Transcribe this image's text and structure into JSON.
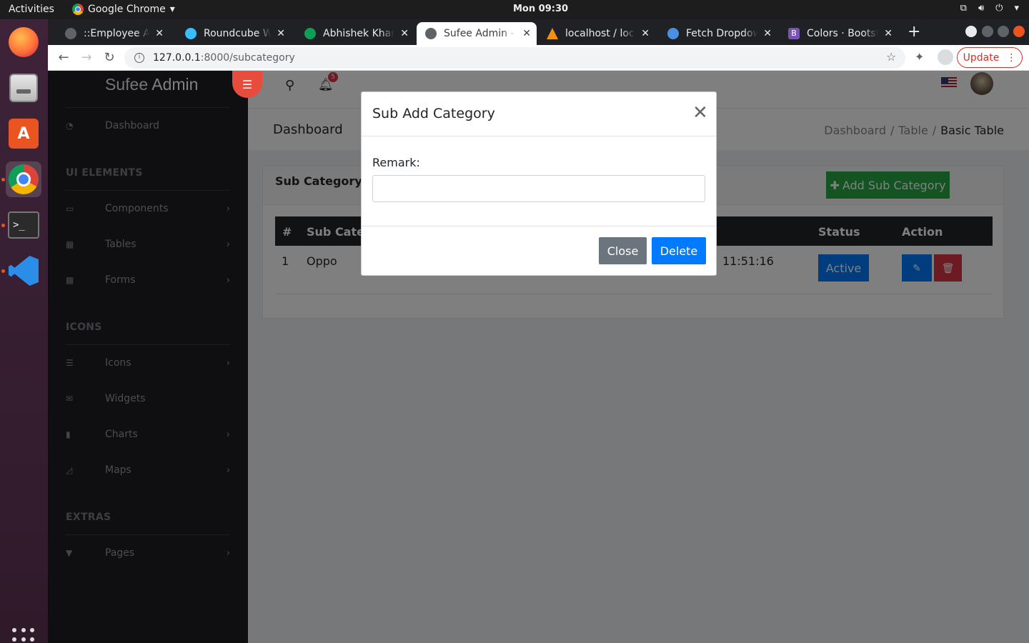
{
  "system": {
    "activities_label": "Activities",
    "app_name": "Google Chrome",
    "clock": "Mon 09:30"
  },
  "browser": {
    "tabs": [
      {
        "title": "::Employee Adm",
        "favicon_color": "#5f6368"
      },
      {
        "title": "Roundcube We",
        "favicon_color": "#37beff"
      },
      {
        "title": "Abhishek Khan",
        "favicon_color": "#0f9d58"
      },
      {
        "title": "Sufee Admin - H",
        "favicon_color": "#5f6368"
      },
      {
        "title": "localhost / loca",
        "favicon_color": "#f29111"
      },
      {
        "title": "Fetch Dropdow",
        "favicon_color": "#4a90e2"
      },
      {
        "title": "Colors · Bootst",
        "favicon_color": "#7952b3"
      }
    ],
    "url_host": "127.0.0.1",
    "url_path": ":8000/subcategory",
    "update_label": "Update"
  },
  "sidebar": {
    "brand_bold": "Sufee",
    "brand_light": " Admin",
    "dashboard": "Dashboard",
    "heading_ui": "UI ELEMENTS",
    "components": "Components",
    "tables": "Tables",
    "forms": "Forms",
    "heading_icons": "ICONS",
    "icons": "Icons",
    "widgets": "Widgets",
    "charts": "Charts",
    "maps": "Maps",
    "heading_extras": "EXTRAS",
    "pages": "Pages"
  },
  "header": {
    "notification_count": "5"
  },
  "breadcrumbs": {
    "title": "Dashboard",
    "items": [
      "Dashboard",
      "Table",
      "Basic Table"
    ]
  },
  "card": {
    "title": "Sub Category",
    "add_button": "Add Sub Category",
    "columns": [
      "#",
      "Sub Category",
      "Status",
      "Action"
    ],
    "rows": [
      {
        "index": "1",
        "name": "Oppo",
        "time": "11:51:16",
        "status": "Active"
      }
    ]
  },
  "modal": {
    "title": "Sub Add Category",
    "remark_label": "Remark:",
    "remark_value": "",
    "close_label": "Close",
    "delete_label": "Delete"
  }
}
